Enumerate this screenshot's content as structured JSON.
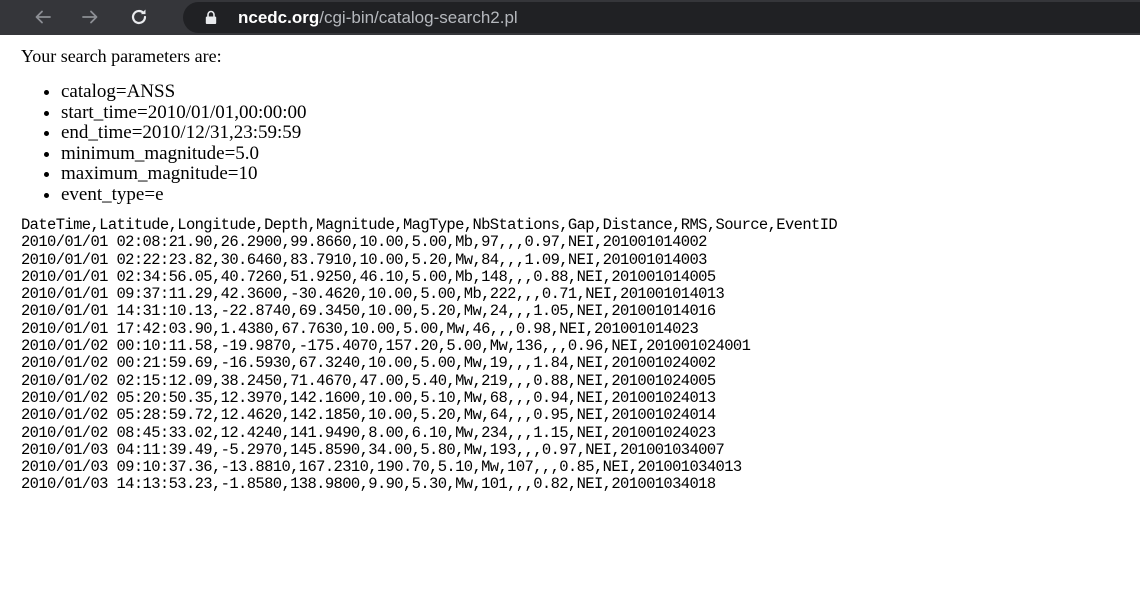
{
  "browser": {
    "url_domain": "ncedc.org",
    "url_path": "/cgi-bin/catalog-search2.pl"
  },
  "page": {
    "intro": "Your search parameters are:",
    "params": [
      "catalog=ANSS",
      "start_time=2010/01/01,00:00:00",
      "end_time=2010/12/31,23:59:59",
      "minimum_magnitude=5.0",
      "maximum_magnitude=10",
      "event_type=e"
    ],
    "csv_header": "DateTime,Latitude,Longitude,Depth,Magnitude,MagType,NbStations,Gap,Distance,RMS,Source,EventID",
    "csv_rows": [
      "2010/01/01 02:08:21.90,26.2900,99.8660,10.00,5.00,Mb,97,,,0.97,NEI,201001014002",
      "2010/01/01 02:22:23.82,30.6460,83.7910,10.00,5.20,Mw,84,,,1.09,NEI,201001014003",
      "2010/01/01 02:34:56.05,40.7260,51.9250,46.10,5.00,Mb,148,,,0.88,NEI,201001014005",
      "2010/01/01 09:37:11.29,42.3600,-30.4620,10.00,5.00,Mb,222,,,0.71,NEI,201001014013",
      "2010/01/01 14:31:10.13,-22.8740,69.3450,10.00,5.20,Mw,24,,,1.05,NEI,201001014016",
      "2010/01/01 17:42:03.90,1.4380,67.7630,10.00,5.00,Mw,46,,,0.98,NEI,201001014023",
      "2010/01/02 00:10:11.58,-19.9870,-175.4070,157.20,5.00,Mw,136,,,0.96,NEI,201001024001",
      "2010/01/02 00:21:59.69,-16.5930,67.3240,10.00,5.00,Mw,19,,,1.84,NEI,201001024002",
      "2010/01/02 02:15:12.09,38.2450,71.4670,47.00,5.40,Mw,219,,,0.88,NEI,201001024005",
      "2010/01/02 05:20:50.35,12.3970,142.1600,10.00,5.10,Mw,68,,,0.94,NEI,201001024013",
      "2010/01/02 05:28:59.72,12.4620,142.1850,10.00,5.20,Mw,64,,,0.95,NEI,201001024014",
      "2010/01/02 08:45:33.02,12.4240,141.9490,8.00,6.10,Mw,234,,,1.15,NEI,201001024023",
      "2010/01/03 04:11:39.49,-5.2970,145.8590,34.00,5.80,Mw,193,,,0.97,NEI,201001034007",
      "2010/01/03 09:10:37.36,-13.8810,167.2310,190.70,5.10,Mw,107,,,0.85,NEI,201001034013",
      "2010/01/03 14:13:53.23,-1.8580,138.9800,9.90,5.30,Mw,101,,,0.82,NEI,201001034018"
    ]
  }
}
